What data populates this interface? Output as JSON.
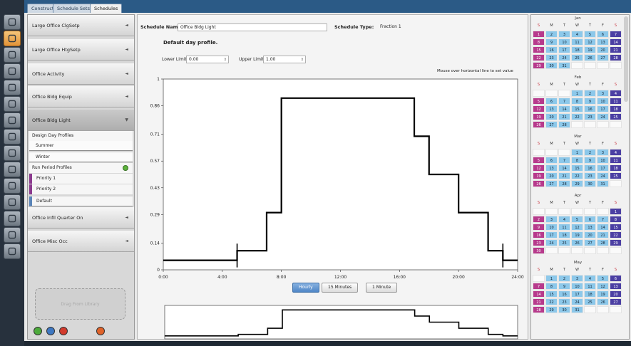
{
  "tabs": [
    {
      "label": "Constructions",
      "active": false
    },
    {
      "label": "Schedule Sets",
      "active": false
    },
    {
      "label": "Schedules",
      "active": true
    }
  ],
  "toolbar_icons": [
    "site-icon",
    "schedules-icon",
    "constructions-icon",
    "loads-icon",
    "space-types-icon",
    "geometry-icon",
    "facility-icon",
    "spaces-icon",
    "thermal-zones-icon",
    "hvac-icon",
    "output-variables-icon",
    "simulation-settings-icon",
    "measures-icon",
    "run-icon",
    "results-icon"
  ],
  "schedule_list": {
    "items": [
      {
        "label": "Large Office ClgSetp"
      },
      {
        "label": "Large Office HtgSetp"
      },
      {
        "label": "Office Activity"
      },
      {
        "label": "Office Bldg Equip"
      },
      {
        "label": "Office Bldg Light"
      },
      {
        "label": "Office Infil Quarter On"
      },
      {
        "label": "Office Misc Occ"
      }
    ],
    "design_day_header": "Design Day Profiles",
    "summer": "Summer",
    "winter": "Winter",
    "run_period_header": "Run Period Profiles",
    "priority1": "Priority 1",
    "priority2": "Priority 2",
    "default": "Default",
    "drag_label": "Drag From Library"
  },
  "editor": {
    "name_label": "Schedule Name:",
    "name_value": "Office Bldg Light",
    "type_label": "Schedule Type:",
    "type_value": "Fraction 1",
    "profile_title": "Default day profile.",
    "lower_label": "Lower Limit:",
    "lower_value": "0.00",
    "upper_label": "Upper Limit:",
    "upper_value": "1.00",
    "hint": "Mouse over horizontal line to set value",
    "view_buttons": [
      {
        "label": "Hourly",
        "active": true
      },
      {
        "label": "15 Minutes",
        "active": false
      },
      {
        "label": "1 Minute",
        "active": false
      }
    ]
  },
  "chart_data": {
    "type": "line",
    "step": true,
    "x_ticks": [
      "0:00",
      "4:00",
      "8:00",
      "12:00",
      "16:00",
      "20:00",
      "24:00"
    ],
    "y_ticks": [
      "0",
      "0.14",
      "0.29",
      "0.43",
      "0.57",
      "0.71",
      "0.86",
      "1"
    ],
    "xlim": [
      0,
      24
    ],
    "ylim": [
      0,
      1
    ],
    "points": [
      [
        0,
        0.05
      ],
      [
        5,
        0.05
      ],
      [
        5,
        0.1
      ],
      [
        7,
        0.1
      ],
      [
        7,
        0.3
      ],
      [
        8,
        0.3
      ],
      [
        8,
        0.9
      ],
      [
        17,
        0.9
      ],
      [
        17,
        0.7
      ],
      [
        18,
        0.7
      ],
      [
        18,
        0.5
      ],
      [
        20,
        0.5
      ],
      [
        20,
        0.3
      ],
      [
        22,
        0.3
      ],
      [
        22,
        0.1
      ],
      [
        23,
        0.1
      ],
      [
        23,
        0.05
      ],
      [
        24,
        0.05
      ]
    ],
    "markers": [
      5,
      23
    ]
  },
  "calendar": {
    "day_headers": [
      "S",
      "M",
      "T",
      "W",
      "T",
      "F",
      "S"
    ],
    "months": [
      {
        "name": "Jan",
        "start": 0,
        "days": 31
      },
      {
        "name": "Feb",
        "start": 3,
        "days": 28
      },
      {
        "name": "Mar",
        "start": 3,
        "days": 31
      },
      {
        "name": "Apr",
        "start": 6,
        "days": 30
      },
      {
        "name": "May",
        "start": 1,
        "days": 31
      }
    ]
  }
}
